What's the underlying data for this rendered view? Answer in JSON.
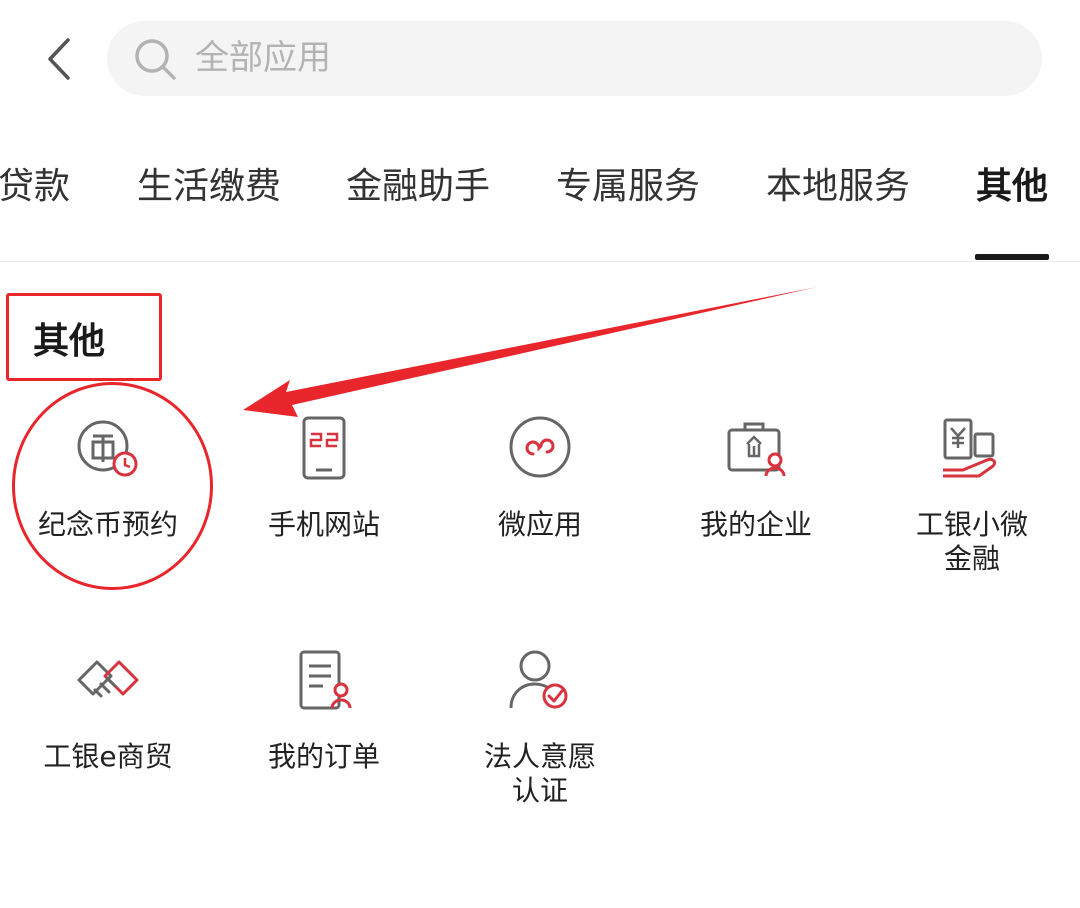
{
  "search": {
    "placeholder": "全部应用"
  },
  "tabs": [
    {
      "label": "贷款"
    },
    {
      "label": "生活缴费"
    },
    {
      "label": "金融助手"
    },
    {
      "label": "专属服务"
    },
    {
      "label": "本地服务"
    },
    {
      "label": "其他",
      "active": true
    }
  ],
  "section": {
    "title": "其他"
  },
  "apps": [
    {
      "label": "纪念币预约",
      "icon": "commemorative-coin-icon"
    },
    {
      "label": "手机网站",
      "icon": "mobile-site-icon"
    },
    {
      "label": "微应用",
      "icon": "micro-app-icon"
    },
    {
      "label": "我的企业",
      "icon": "my-enterprise-icon"
    },
    {
      "label": "工银小微\n金融",
      "icon": "small-business-finance-icon"
    },
    {
      "label": "工银e商贸",
      "icon": "handshake-icon"
    },
    {
      "label": "我的订单",
      "icon": "order-icon"
    },
    {
      "label": "法人意愿\n认证",
      "icon": "person-verify-icon"
    }
  ],
  "colors": {
    "accent": "#e8262c",
    "icon_gray": "#666666"
  }
}
